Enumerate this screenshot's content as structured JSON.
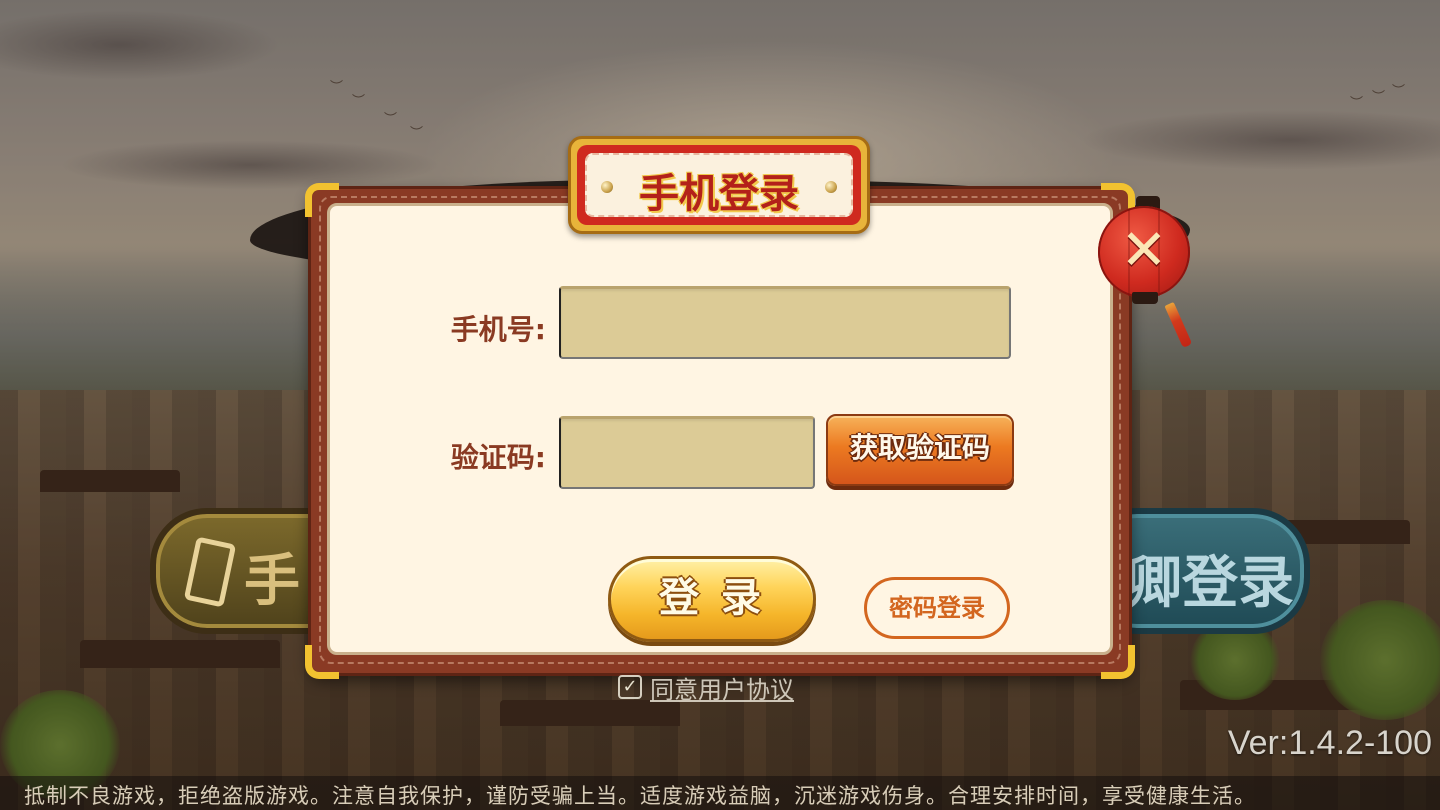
{
  "dialog": {
    "title": "手机登录",
    "phone_label": "手机号:",
    "phone_value": "",
    "code_label": "验证码:",
    "code_value": "",
    "get_code_label": "获取验证码",
    "login_label": "登 录",
    "password_login_label": "密码登录",
    "close_icon": "close-icon"
  },
  "background": {
    "left_button_label": "手",
    "right_button_label": "卿登录"
  },
  "agreement": {
    "checked": true,
    "check_mark": "✓",
    "label": "同意用户协议"
  },
  "version": "Ver:1.4.2-100",
  "footer": {
    "notice": "抵制不良游戏，拒绝盗版游戏。注意自我保护，谨防受骗上当。适度游戏益脑，沉迷游戏伤身。合理安排时间，享受健康生活。"
  },
  "colors": {
    "accent_red": "#cf2a1f",
    "button_orange": "#ec7a21",
    "button_gold": "#f5b52a",
    "panel_cream": "#fff5e3"
  }
}
